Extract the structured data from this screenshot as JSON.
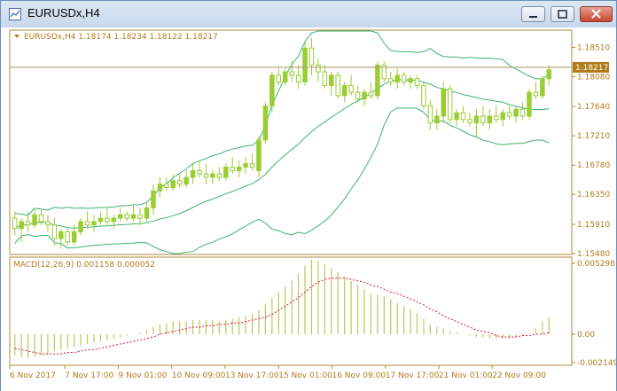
{
  "window": {
    "title": "EURUSDx,H4"
  },
  "chart_info": "EURUSDx,H4  1.18174 1.18234 1.18122 1.18217",
  "macd_info": "MACD(12,26,9) 0.001158 0.000052",
  "price_axis": [
    "1.18510",
    "1.18080",
    "1.17640",
    "1.17210",
    "1.16780",
    "1.16350",
    "1.15910",
    "1.15480"
  ],
  "current_price": "1.18217",
  "macd_axis": [
    "0.005298",
    "0.00",
    "-0.002149"
  ],
  "time_axis": [
    "6 Nov 2017",
    "7 Nov 17:00",
    "9 Nov 01:00",
    "10 Nov 09:00",
    "13 Nov 17:00",
    "15 Nov 01:00",
    "16 Nov 09:00",
    "17 Nov 17:00",
    "21 Nov 01:00",
    "22 Nov 09:00"
  ],
  "colors": {
    "bull": "#9acd32",
    "band": "#3cb371",
    "signal": "#dc143c",
    "macd": "#b8c85a",
    "axis": "#b07b1a"
  },
  "chart_data": {
    "type": "candlestick",
    "symbol": "EURUSDx",
    "timeframe": "H4",
    "ylim": [
      1.1548,
      1.1875
    ],
    "candles": [
      [
        1.16,
        1.161,
        1.1575,
        1.1585
      ],
      [
        1.1585,
        1.16,
        1.1565,
        1.1595
      ],
      [
        1.1595,
        1.161,
        1.158,
        1.159
      ],
      [
        1.159,
        1.1615,
        1.1585,
        1.1605
      ],
      [
        1.1605,
        1.1612,
        1.159,
        1.1595
      ],
      [
        1.1595,
        1.1605,
        1.158,
        1.159
      ],
      [
        1.159,
        1.16,
        1.156,
        1.157
      ],
      [
        1.157,
        1.1585,
        1.1555,
        1.158
      ],
      [
        1.158,
        1.1585,
        1.156,
        1.1565
      ],
      [
        1.1565,
        1.159,
        1.156,
        1.158
      ],
      [
        1.158,
        1.16,
        1.1575,
        1.1595
      ],
      [
        1.1595,
        1.161,
        1.1585,
        1.159
      ],
      [
        1.159,
        1.1605,
        1.158,
        1.1595
      ],
      [
        1.1595,
        1.161,
        1.159,
        1.16
      ],
      [
        1.16,
        1.1615,
        1.159,
        1.1595
      ],
      [
        1.1595,
        1.1605,
        1.1585,
        1.16
      ],
      [
        1.16,
        1.1615,
        1.1595,
        1.1605
      ],
      [
        1.1605,
        1.161,
        1.1595,
        1.16
      ],
      [
        1.16,
        1.162,
        1.1595,
        1.1605
      ],
      [
        1.1605,
        1.1615,
        1.159,
        1.16
      ],
      [
        1.16,
        1.1625,
        1.1595,
        1.1615
      ],
      [
        1.1615,
        1.165,
        1.1605,
        1.164
      ],
      [
        1.164,
        1.166,
        1.163,
        1.165
      ],
      [
        1.165,
        1.166,
        1.164,
        1.1645
      ],
      [
        1.1645,
        1.1665,
        1.164,
        1.1655
      ],
      [
        1.1655,
        1.1665,
        1.1645,
        1.165
      ],
      [
        1.165,
        1.167,
        1.1645,
        1.166
      ],
      [
        1.166,
        1.168,
        1.165,
        1.167
      ],
      [
        1.167,
        1.1685,
        1.166,
        1.1665
      ],
      [
        1.1665,
        1.168,
        1.165,
        1.166
      ],
      [
        1.166,
        1.167,
        1.165,
        1.1665
      ],
      [
        1.1665,
        1.1675,
        1.1655,
        1.166
      ],
      [
        1.166,
        1.168,
        1.1655,
        1.1675
      ],
      [
        1.1675,
        1.169,
        1.1665,
        1.167
      ],
      [
        1.167,
        1.1685,
        1.166,
        1.1675
      ],
      [
        1.1675,
        1.169,
        1.1665,
        1.168
      ],
      [
        1.168,
        1.1695,
        1.167,
        1.1675
      ],
      [
        1.167,
        1.172,
        1.166,
        1.1715
      ],
      [
        1.1715,
        1.177,
        1.171,
        1.1765
      ],
      [
        1.1765,
        1.1815,
        1.1755,
        1.181
      ],
      [
        1.181,
        1.182,
        1.1795,
        1.18
      ],
      [
        1.18,
        1.182,
        1.1795,
        1.1815
      ],
      [
        1.1815,
        1.183,
        1.18,
        1.181
      ],
      [
        1.181,
        1.1825,
        1.179,
        1.18
      ],
      [
        1.18,
        1.186,
        1.1795,
        1.185
      ],
      [
        1.185,
        1.1865,
        1.181,
        1.1825
      ],
      [
        1.1825,
        1.1835,
        1.18,
        1.1815
      ],
      [
        1.1815,
        1.1825,
        1.179,
        1.1795
      ],
      [
        1.1795,
        1.1815,
        1.178,
        1.181
      ],
      [
        1.181,
        1.1815,
        1.1775,
        1.178
      ],
      [
        1.178,
        1.18,
        1.177,
        1.1795
      ],
      [
        1.1795,
        1.181,
        1.178,
        1.1785
      ],
      [
        1.1785,
        1.1795,
        1.177,
        1.1775
      ],
      [
        1.1775,
        1.179,
        1.1765,
        1.1785
      ],
      [
        1.1785,
        1.18,
        1.1775,
        1.178
      ],
      [
        1.178,
        1.183,
        1.1775,
        1.1825
      ],
      [
        1.1825,
        1.183,
        1.18,
        1.1805
      ],
      [
        1.1805,
        1.1815,
        1.1795,
        1.18
      ],
      [
        1.18,
        1.182,
        1.179,
        1.181
      ],
      [
        1.181,
        1.1815,
        1.1795,
        1.18
      ],
      [
        1.18,
        1.181,
        1.179,
        1.1805
      ],
      [
        1.1805,
        1.181,
        1.179,
        1.1795
      ],
      [
        1.1795,
        1.18,
        1.176,
        1.1765
      ],
      [
        1.1765,
        1.1775,
        1.173,
        1.174
      ],
      [
        1.174,
        1.176,
        1.173,
        1.175
      ],
      [
        1.175,
        1.18,
        1.174,
        1.179
      ],
      [
        1.179,
        1.1795,
        1.174,
        1.1745
      ],
      [
        1.1745,
        1.176,
        1.1735,
        1.1755
      ],
      [
        1.1755,
        1.1765,
        1.174,
        1.1745
      ],
      [
        1.1745,
        1.1755,
        1.1735,
        1.174
      ],
      [
        1.174,
        1.176,
        1.172,
        1.175
      ],
      [
        1.175,
        1.1765,
        1.1735,
        1.174
      ],
      [
        1.174,
        1.176,
        1.173,
        1.175
      ],
      [
        1.175,
        1.1765,
        1.174,
        1.1745
      ],
      [
        1.1745,
        1.176,
        1.1735,
        1.1755
      ],
      [
        1.1755,
        1.1765,
        1.1745,
        1.175
      ],
      [
        1.175,
        1.1765,
        1.174,
        1.176
      ],
      [
        1.176,
        1.177,
        1.1745,
        1.175
      ],
      [
        1.175,
        1.179,
        1.1745,
        1.1785
      ],
      [
        1.1785,
        1.18,
        1.1775,
        1.178
      ],
      [
        1.178,
        1.181,
        1.1775,
        1.1805
      ],
      [
        1.1805,
        1.1825,
        1.1795,
        1.1818
      ]
    ],
    "macd": [
      -0.0015,
      -0.0016,
      -0.0017,
      -0.0016,
      -0.0015,
      -0.0014,
      -0.0012,
      -0.0011,
      -0.001,
      -0.0009,
      -0.0008,
      -0.0007,
      -0.0006,
      -0.0005,
      -0.0004,
      -0.0003,
      -0.0002,
      -0.0001,
      0.0,
      0.0001,
      0.0003,
      0.0005,
      0.0007,
      0.0008,
      0.0009,
      0.0009,
      0.0009,
      0.001,
      0.001,
      0.001,
      0.001,
      0.0009,
      0.001,
      0.0011,
      0.0012,
      0.0013,
      0.0014,
      0.0017,
      0.0021,
      0.0026,
      0.003,
      0.0034,
      0.0038,
      0.0043,
      0.0049,
      0.0053,
      0.0052,
      0.005,
      0.0047,
      0.0044,
      0.0041,
      0.0038,
      0.0035,
      0.0032,
      0.0029,
      0.0028,
      0.0027,
      0.0025,
      0.0022,
      0.002,
      0.0018,
      0.0015,
      0.0011,
      0.0007,
      0.0005,
      0.0004,
      0.0002,
      0.0001,
      0.0,
      -0.0001,
      -0.0002,
      -0.0002,
      -0.0003,
      -0.0003,
      -0.0003,
      -0.0003,
      -0.0002,
      -0.0001,
      0.0,
      0.0004,
      0.0009,
      0.0012
    ],
    "signal": [
      -0.001,
      -0.0011,
      -0.0012,
      -0.0013,
      -0.0014,
      -0.0014,
      -0.0014,
      -0.0014,
      -0.0013,
      -0.0013,
      -0.0012,
      -0.0011,
      -0.0011,
      -0.001,
      -0.0009,
      -0.0008,
      -0.0007,
      -0.0006,
      -0.0005,
      -0.0004,
      -0.0003,
      -0.0002,
      0.0,
      0.0001,
      0.0002,
      0.0003,
      0.0004,
      0.0005,
      0.0005,
      0.0006,
      0.0006,
      0.0007,
      0.0007,
      0.0008,
      0.0008,
      0.0009,
      0.001,
      0.0011,
      0.0012,
      0.0014,
      0.0017,
      0.002,
      0.0023,
      0.0026,
      0.003,
      0.0034,
      0.0037,
      0.0039,
      0.004,
      0.004,
      0.004,
      0.0039,
      0.0038,
      0.0037,
      0.0035,
      0.0034,
      0.0032,
      0.003,
      0.0029,
      0.0027,
      0.0025,
      0.0023,
      0.0021,
      0.0018,
      0.0016,
      0.0013,
      0.0011,
      0.0009,
      0.0007,
      0.0005,
      0.0003,
      0.0002,
      0.0001,
      -0.0001,
      -0.0002,
      -0.0002,
      -0.0002,
      -0.0001,
      -0.0001,
      0.0,
      0.0,
      0.0001
    ],
    "macd_ylim": [
      -0.002149,
      0.005298
    ]
  }
}
